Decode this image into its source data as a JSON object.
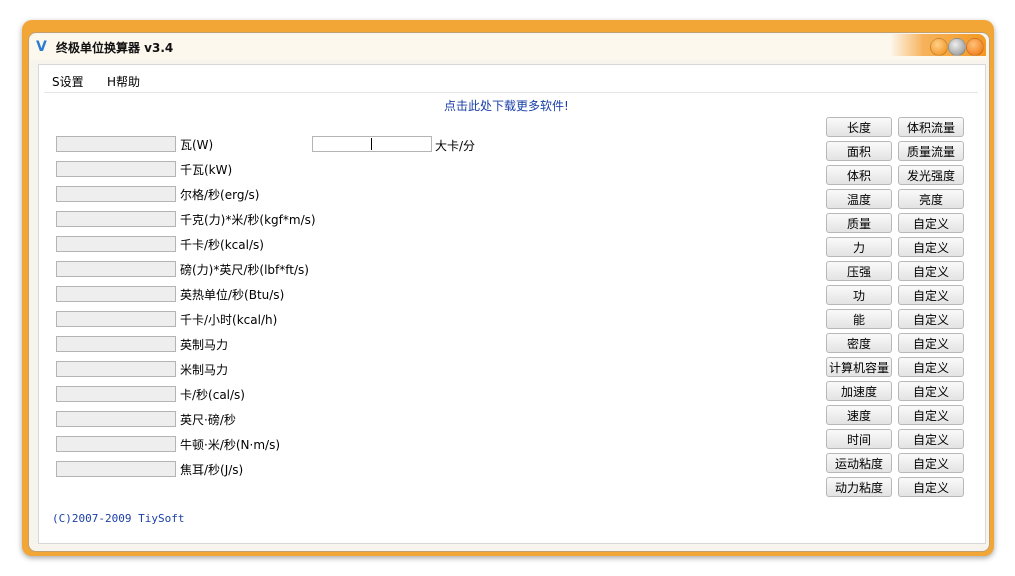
{
  "window": {
    "title": "终极单位换算器 v3.4",
    "app_icon": "V"
  },
  "menu": {
    "settings": "S设置",
    "help": "H帮助"
  },
  "download_link": "点击此处下载更多软件!",
  "units": [
    {
      "label": "瓦(W)",
      "value": ""
    },
    {
      "label": "千瓦(kW)",
      "value": ""
    },
    {
      "label": "尔格/秒(erg/s)",
      "value": ""
    },
    {
      "label": "千克(力)*米/秒(kgf*m/s)",
      "value": ""
    },
    {
      "label": "千卡/秒(kcal/s)",
      "value": ""
    },
    {
      "label": "磅(力)*英尺/秒(lbf*ft/s)",
      "value": ""
    },
    {
      "label": "英热单位/秒(Btu/s)",
      "value": ""
    },
    {
      "label": "千卡/小时(kcal/h)",
      "value": ""
    },
    {
      "label": "英制马力",
      "value": ""
    },
    {
      "label": "米制马力",
      "value": ""
    },
    {
      "label": "卡/秒(cal/s)",
      "value": ""
    },
    {
      "label": "英尺·磅/秒",
      "value": ""
    },
    {
      "label": "牛顿·米/秒(N·m/s)",
      "value": ""
    },
    {
      "label": "焦耳/秒(J/s)",
      "value": ""
    }
  ],
  "active_unit": {
    "label": "大卡/分",
    "value": ""
  },
  "categories_left": [
    "长度",
    "面积",
    "体积",
    "温度",
    "质量",
    "力",
    "压强",
    "功",
    "能",
    "密度",
    "计算机容量",
    "加速度",
    "速度",
    "时间",
    "运动粘度",
    "动力粘度"
  ],
  "categories_right": [
    "体积流量",
    "质量流量",
    "发光强度",
    "亮度",
    "自定义",
    "自定义",
    "自定义",
    "自定义",
    "自定义",
    "自定义",
    "自定义",
    "自定义",
    "自定义",
    "自定义",
    "自定义",
    "自定义"
  ],
  "copyright": "(C)2007-2009 TiySoft",
  "colors": {
    "frame": "#f2a636",
    "link": "#1a3fa8",
    "accent_orange": "#f39a21"
  }
}
